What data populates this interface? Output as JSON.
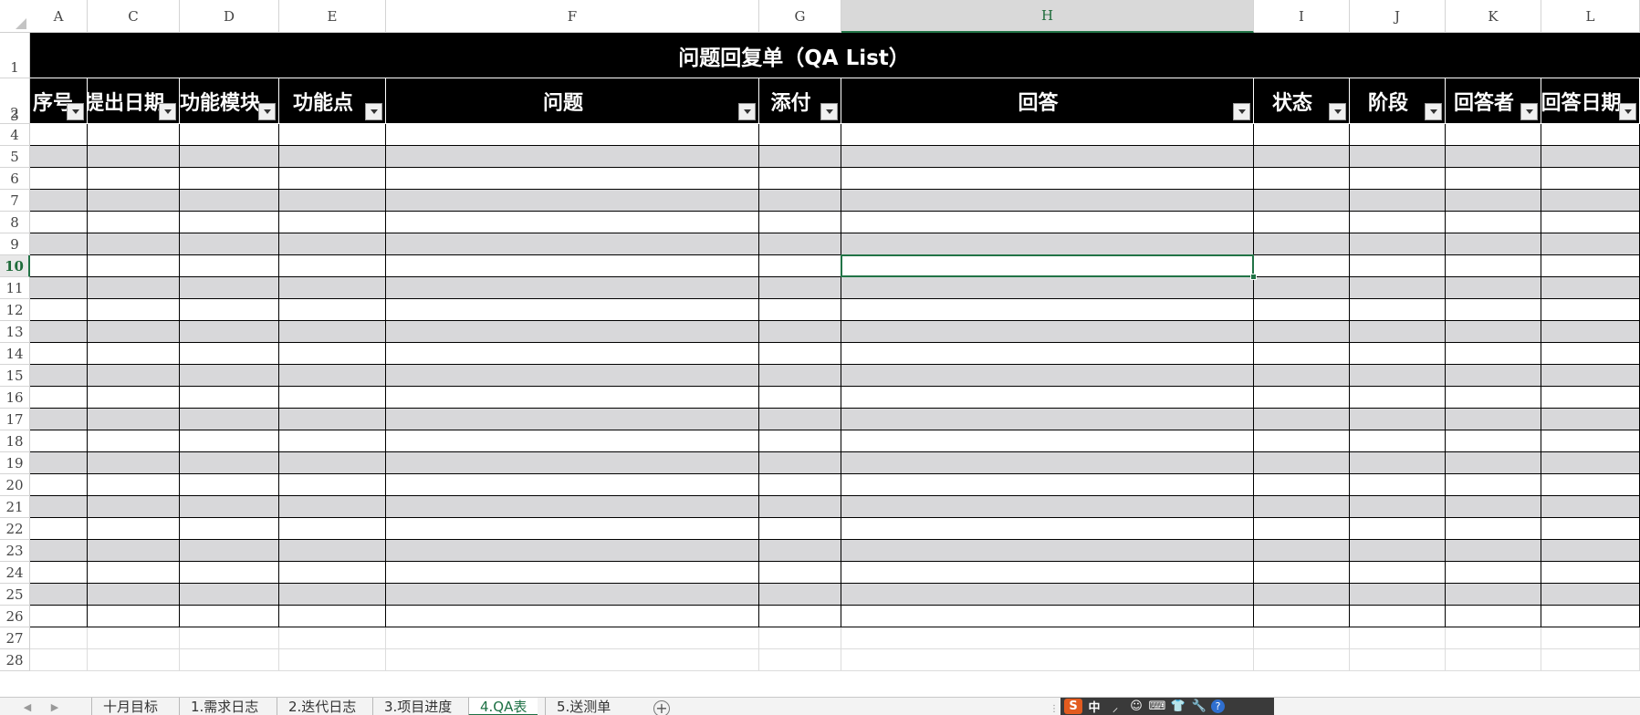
{
  "columns": [
    "A",
    "C",
    "D",
    "E",
    "F",
    "G",
    "H",
    "I",
    "J",
    "K",
    "L"
  ],
  "selected_column": "H",
  "row_numbers": [
    "1",
    "2",
    "3",
    "4",
    "5",
    "6",
    "7",
    "8",
    "9",
    "10",
    "11",
    "12",
    "13",
    "14",
    "15",
    "16",
    "17",
    "18",
    "19",
    "20",
    "21",
    "22",
    "23",
    "24",
    "25",
    "26",
    "27",
    "28"
  ],
  "selected_row": "10",
  "title": "问题回复单（QA List）",
  "headers": [
    "序号",
    "提出日期",
    "功能模块",
    "功能点",
    "问题",
    "添付",
    "回答",
    "状态",
    "阶段",
    "回答者",
    "回答日期"
  ],
  "sheet_tabs": [
    "十月目标",
    "1.需求日志",
    "2.迭代日志",
    "3.项目进度",
    "4.QA表",
    "5.送测单"
  ],
  "active_tab": "4.QA表",
  "colors": {
    "header_bg": "#000000",
    "band_gray": "#d8d8da",
    "accent_green": "#217346"
  },
  "ime_toolbar": {
    "brand": "S",
    "mode": "中"
  }
}
